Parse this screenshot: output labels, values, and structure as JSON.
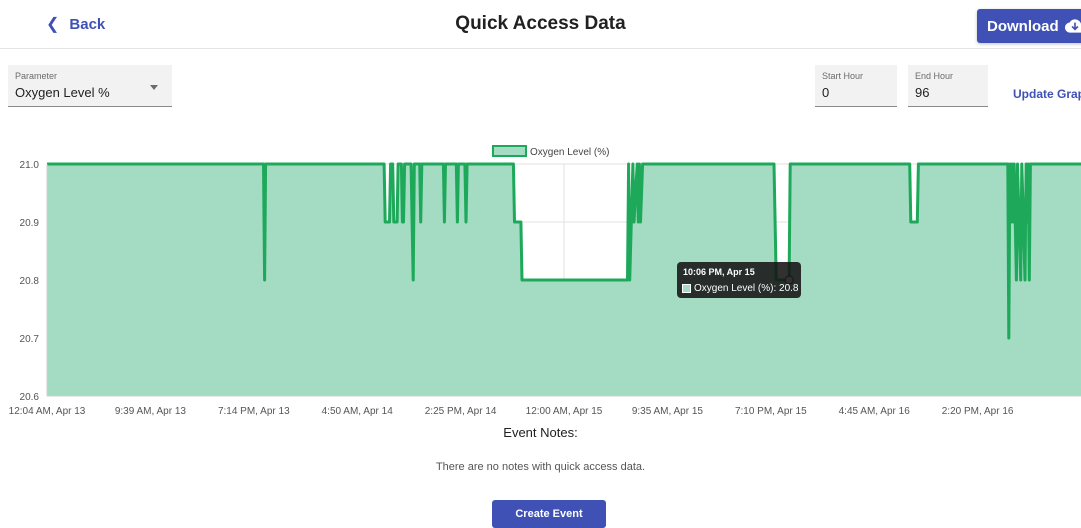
{
  "header": {
    "back_label": "Back",
    "title": "Quick Access Data",
    "download_label": "Download",
    "download_icon": "cloud-download-icon"
  },
  "controls": {
    "parameter_label": "Parameter",
    "parameter_value": "Oxygen Level %",
    "start_hour_label": "Start Hour",
    "start_hour_value": "0",
    "end_hour_label": "End Hour",
    "end_hour_value": "96",
    "update_label": "Update Graph"
  },
  "tooltip": {
    "title": "10:06 PM, Apr 15",
    "line": "Oxygen Level (%): 20.8"
  },
  "notes": {
    "title": "Event Notes:",
    "empty_text": "There are no notes with quick access data.",
    "create_label": "Create Event"
  },
  "colors": {
    "accent": "#3f51b5",
    "series_line": "#1ea85a",
    "series_fill": "#a3dcc3"
  },
  "chart_data": {
    "type": "area",
    "legend": [
      "Oxygen Level (%)"
    ],
    "legend_position": "top",
    "ylim": [
      20.6,
      21.0
    ],
    "yticks": [
      21.0,
      20.9,
      20.8,
      20.7,
      20.6
    ],
    "xlim": [
      0,
      96
    ],
    "xticks": [
      {
        "x": 0,
        "label": "12:04 AM, Apr 13"
      },
      {
        "x": 9.6,
        "label": "9:39 AM, Apr 13"
      },
      {
        "x": 19.2,
        "label": "7:14 PM, Apr 13"
      },
      {
        "x": 28.8,
        "label": "4:50 AM, Apr 14"
      },
      {
        "x": 38.4,
        "label": "2:25 PM, Apr 14"
      },
      {
        "x": 48,
        "label": "12:00 AM, Apr 15"
      },
      {
        "x": 57.6,
        "label": "9:35 AM, Apr 15"
      },
      {
        "x": 67.2,
        "label": "7:10 PM, Apr 15"
      },
      {
        "x": 76.8,
        "label": "4:45 AM, Apr 16"
      },
      {
        "x": 86.4,
        "label": "2:20 PM, Apr 16"
      }
    ],
    "series": [
      {
        "name": "Oxygen Level (%)",
        "points": [
          [
            0,
            21.0
          ],
          [
            20.1,
            21.0
          ],
          [
            20.2,
            20.8
          ],
          [
            20.3,
            21.0
          ],
          [
            31.3,
            21.0
          ],
          [
            31.4,
            20.9
          ],
          [
            31.8,
            20.9
          ],
          [
            31.9,
            21.0
          ],
          [
            32.1,
            21.0
          ],
          [
            32.2,
            20.9
          ],
          [
            32.5,
            20.9
          ],
          [
            32.6,
            21.0
          ],
          [
            32.9,
            21.0
          ],
          [
            33.0,
            20.9
          ],
          [
            33.1,
            20.9
          ],
          [
            33.2,
            21.0
          ],
          [
            33.8,
            21.0
          ],
          [
            33.9,
            20.9
          ],
          [
            34.0,
            20.8
          ],
          [
            34.1,
            21.0
          ],
          [
            34.6,
            21.0
          ],
          [
            34.7,
            20.9
          ],
          [
            34.8,
            21.0
          ],
          [
            36.8,
            21.0
          ],
          [
            36.9,
            20.9
          ],
          [
            37.0,
            21.0
          ],
          [
            38.0,
            21.0
          ],
          [
            38.1,
            20.9
          ],
          [
            38.2,
            21.0
          ],
          [
            38.8,
            21.0
          ],
          [
            38.9,
            20.9
          ],
          [
            39.0,
            21.0
          ],
          [
            43.3,
            21.0
          ],
          [
            43.4,
            20.9
          ],
          [
            44.0,
            20.9
          ],
          [
            44.1,
            20.8
          ],
          [
            53.9,
            20.8
          ],
          [
            54.0,
            21.0
          ],
          [
            54.1,
            20.8
          ],
          [
            54.4,
            21.0
          ],
          [
            54.5,
            20.9
          ],
          [
            54.8,
            21.0
          ],
          [
            54.9,
            20.9
          ],
          [
            55.0,
            21.0
          ],
          [
            55.1,
            20.9
          ],
          [
            55.3,
            21.0
          ],
          [
            67.5,
            21.0
          ],
          [
            67.6,
            20.9
          ],
          [
            67.7,
            20.8
          ],
          [
            68.9,
            20.8
          ],
          [
            69.0,
            21.0
          ],
          [
            80.1,
            21.0
          ],
          [
            80.2,
            20.9
          ],
          [
            80.8,
            20.9
          ],
          [
            80.9,
            21.0
          ],
          [
            89.2,
            21.0
          ],
          [
            89.3,
            20.7
          ],
          [
            89.4,
            21.0
          ],
          [
            89.5,
            20.9
          ],
          [
            89.6,
            21.0
          ],
          [
            89.7,
            20.9
          ],
          [
            89.8,
            21.0
          ],
          [
            90.0,
            20.8
          ],
          [
            90.1,
            21.0
          ],
          [
            90.4,
            20.8
          ],
          [
            90.5,
            21.0
          ],
          [
            90.8,
            20.8
          ],
          [
            90.9,
            21.0
          ],
          [
            91.0,
            20.9
          ],
          [
            91.1,
            21.0
          ],
          [
            91.2,
            20.8
          ],
          [
            91.3,
            21.0
          ],
          [
            96,
            21.0
          ]
        ]
      }
    ],
    "highlight_point": {
      "x": 68.9,
      "y": 20.8
    }
  }
}
